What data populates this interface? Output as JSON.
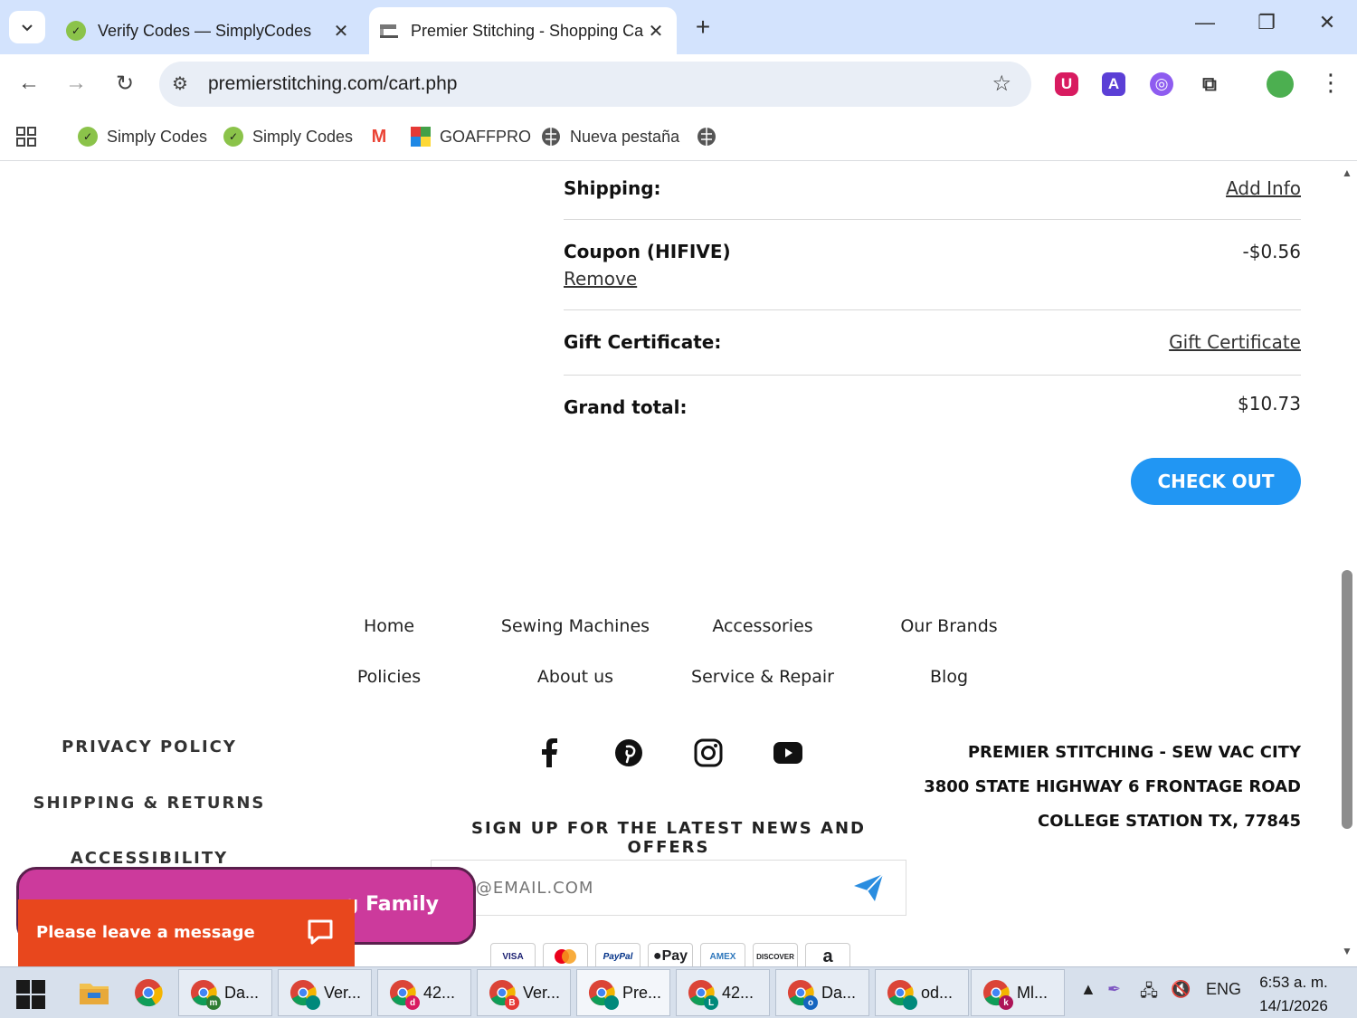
{
  "browser": {
    "tabs": [
      {
        "title": "Verify Codes — SimplyCodes",
        "active": false
      },
      {
        "title": "Premier Stitching - Shopping Ca",
        "active": true
      }
    ],
    "url": "premierstitching.com/cart.php",
    "bookmarks": [
      "Simply Codes",
      "Simply Codes",
      "GOAFFPRO",
      "Nueva pestaña"
    ]
  },
  "cart": {
    "shipping_label": "Shipping:",
    "shipping_action": "Add Info",
    "coupon_label": "Coupon (HIFIVE)",
    "coupon_remove": "Remove",
    "coupon_value": "-$0.56",
    "gift_label": "Gift Certificate:",
    "gift_action": "Gift Certificate",
    "grand_total_label": "Grand total:",
    "grand_total_value": "$10.73",
    "checkout_label": "CHECK OUT"
  },
  "footer": {
    "nav": [
      "Home",
      "Sewing Machines",
      "Accessories",
      "Our Brands",
      "Policies",
      "About us",
      "Service & Repair",
      "Blog"
    ],
    "policies": [
      "PRIVACY POLICY",
      "SHIPPING & RETURNS",
      "ACCESSIBILITY"
    ],
    "address": [
      "PREMIER STITCHING - SEW VAC CITY",
      "3800 STATE HIGHWAY 6 FRONTAGE ROAD",
      "COLLEGE STATION TX, 77845"
    ],
    "signup_title": "SIGN UP FOR THE LATEST NEWS AND OFFERS",
    "email_placeholder": "ME@EMAIL.COM",
    "payment_cards": [
      "VISA",
      "",
      "PayPal",
      "Pay",
      "AMEX",
      "DISCOVER",
      "a"
    ]
  },
  "overlays": {
    "family_banner": "g Family",
    "chat_message": "Please leave a message"
  },
  "taskbar": {
    "items": [
      {
        "label": "Da...",
        "badge": "m",
        "badge_color": "#2e7d32"
      },
      {
        "label": "Ver...",
        "badge": "",
        "badge_color": "#00897b"
      },
      {
        "label": "42...",
        "badge": "d",
        "badge_color": "#d81b60"
      },
      {
        "label": "Ver...",
        "badge": "B",
        "badge_color": "#e53935"
      },
      {
        "label": "Pre...",
        "badge": "",
        "badge_color": "#00897b"
      },
      {
        "label": "42...",
        "badge": "L",
        "badge_color": "#00897b"
      },
      {
        "label": "Da...",
        "badge": "o",
        "badge_color": "#1565c0"
      },
      {
        "label": "od...",
        "badge": "",
        "badge_color": "#00897b"
      },
      {
        "label": "Ml...",
        "badge": "k",
        "badge_color": "#ad1457"
      }
    ],
    "language": "ENG",
    "time": "6:53 a. m.",
    "date": "14/1/2026"
  }
}
